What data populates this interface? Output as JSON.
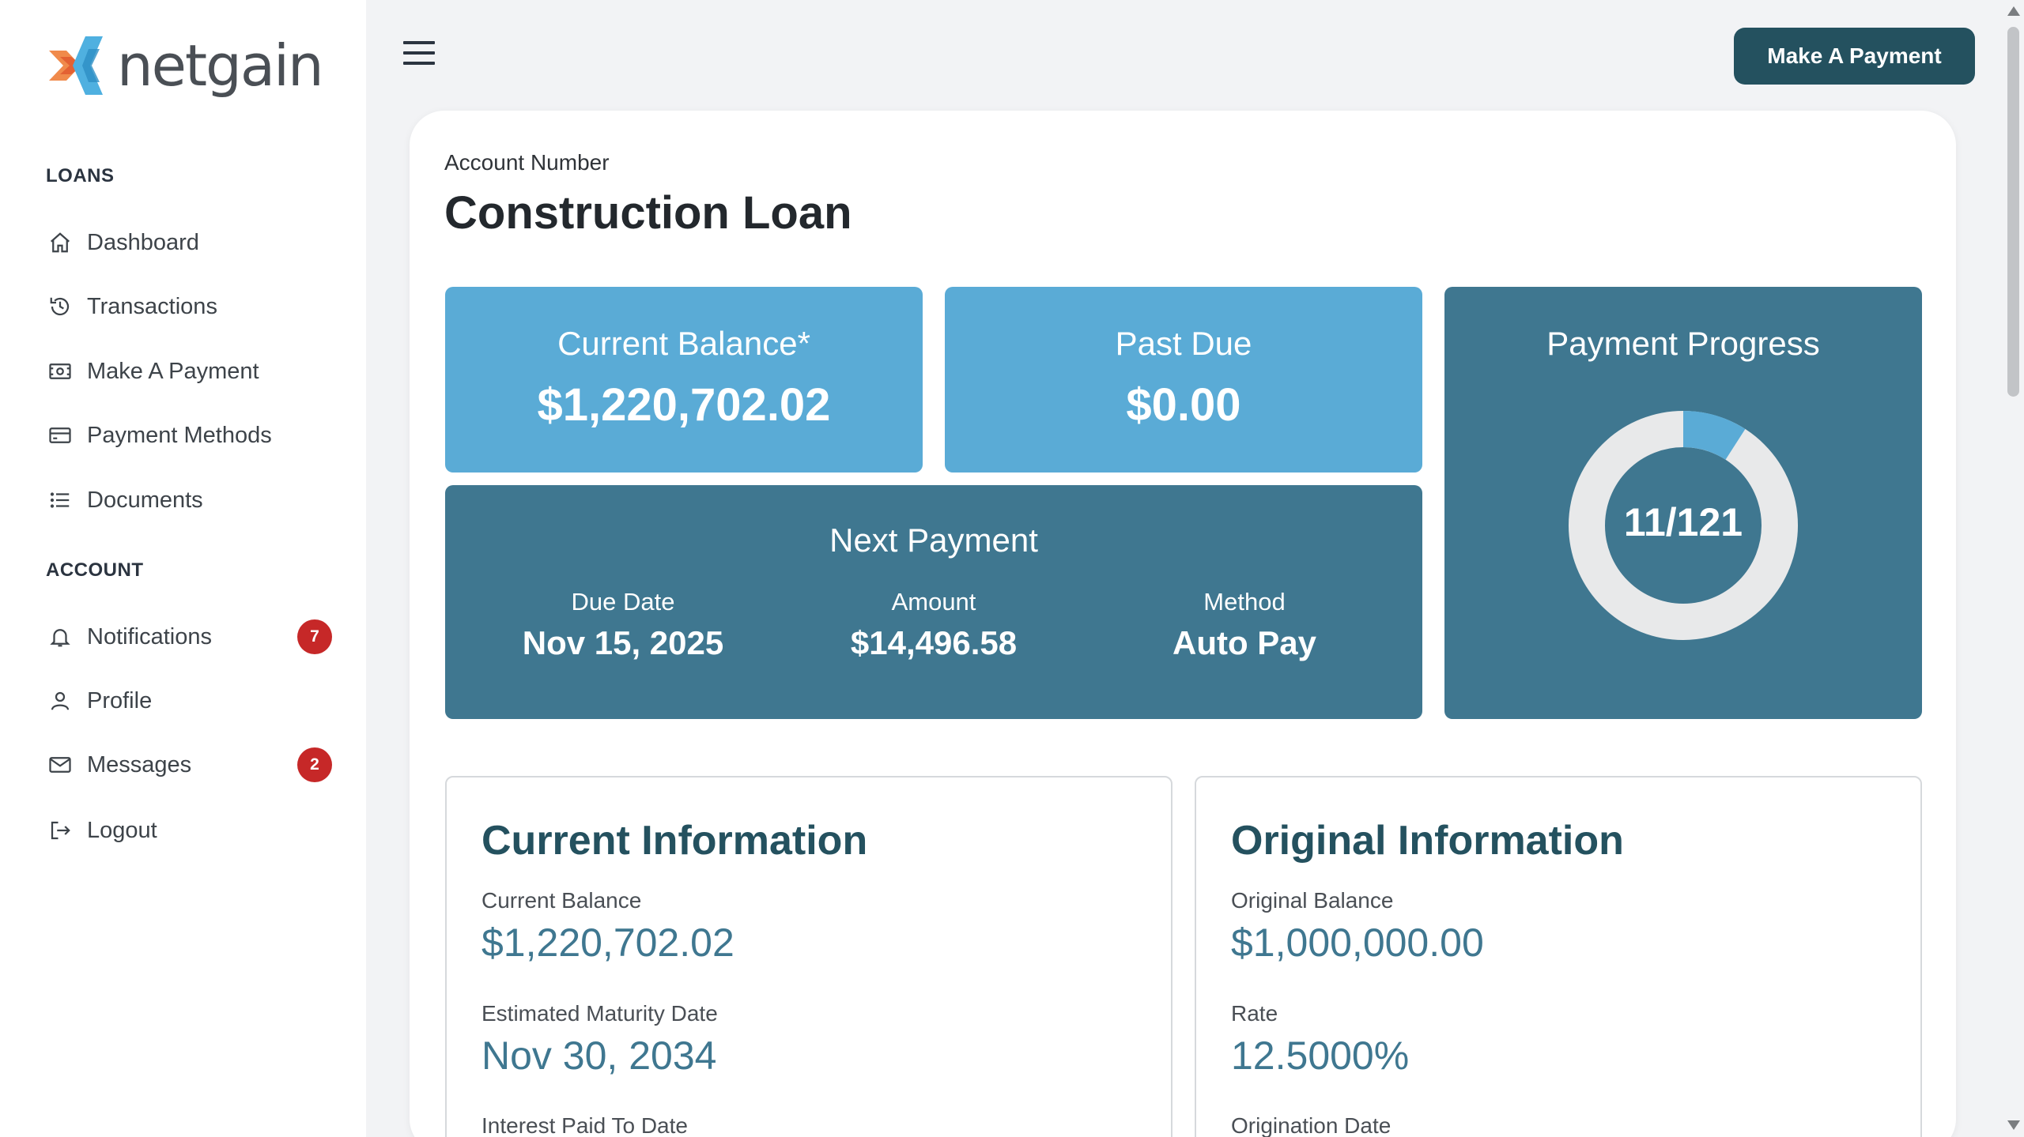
{
  "brand": {
    "name": "netgain"
  },
  "sidebar": {
    "loans_label": "LOANS",
    "account_label": "ACCOUNT",
    "loan_items": [
      {
        "label": "Dashboard",
        "icon": "home-icon"
      },
      {
        "label": "Transactions",
        "icon": "history-icon"
      },
      {
        "label": "Make A Payment",
        "icon": "cash-icon"
      },
      {
        "label": "Payment Methods",
        "icon": "credit-card-icon"
      },
      {
        "label": "Documents",
        "icon": "list-icon"
      }
    ],
    "account_items": [
      {
        "label": "Notifications",
        "icon": "bell-icon",
        "badge": "7"
      },
      {
        "label": "Profile",
        "icon": "person-icon"
      },
      {
        "label": "Messages",
        "icon": "envelope-icon",
        "badge": "2"
      },
      {
        "label": "Logout",
        "icon": "logout-icon"
      }
    ]
  },
  "header": {
    "pay_button": "Make A Payment"
  },
  "loan": {
    "account_label": "Account Number",
    "title": "Construction Loan"
  },
  "tiles": {
    "current_balance": {
      "title": "Current Balance*",
      "value": "$1,220,702.02"
    },
    "past_due": {
      "title": "Past Due",
      "value": "$0.00"
    },
    "next_payment": {
      "title": "Next Payment",
      "due_label": "Due Date",
      "due_value": "Nov 15, 2025",
      "amount_label": "Amount",
      "amount_value": "$14,496.58",
      "method_label": "Method",
      "method_value": "Auto Pay"
    },
    "progress": {
      "title": "Payment Progress",
      "text": "11/121",
      "paid": 11,
      "total": 121
    }
  },
  "current_info": {
    "title": "Current Information",
    "balance_label": "Current Balance",
    "balance_value": "$1,220,702.02",
    "maturity_label": "Estimated Maturity Date",
    "maturity_value": "Nov 30, 2034",
    "interest_label": "Interest Paid To Date"
  },
  "original_info": {
    "title": "Original Information",
    "balance_label": "Original Balance",
    "balance_value": "$1,000,000.00",
    "rate_label": "Rate",
    "rate_value": "12.5000%",
    "origination_label": "Origination Date"
  },
  "colors": {
    "primary_dark": "#24515f",
    "tile_light": "#5aabd6",
    "tile_dark": "#3f7790",
    "badge_red": "#c62828"
  }
}
